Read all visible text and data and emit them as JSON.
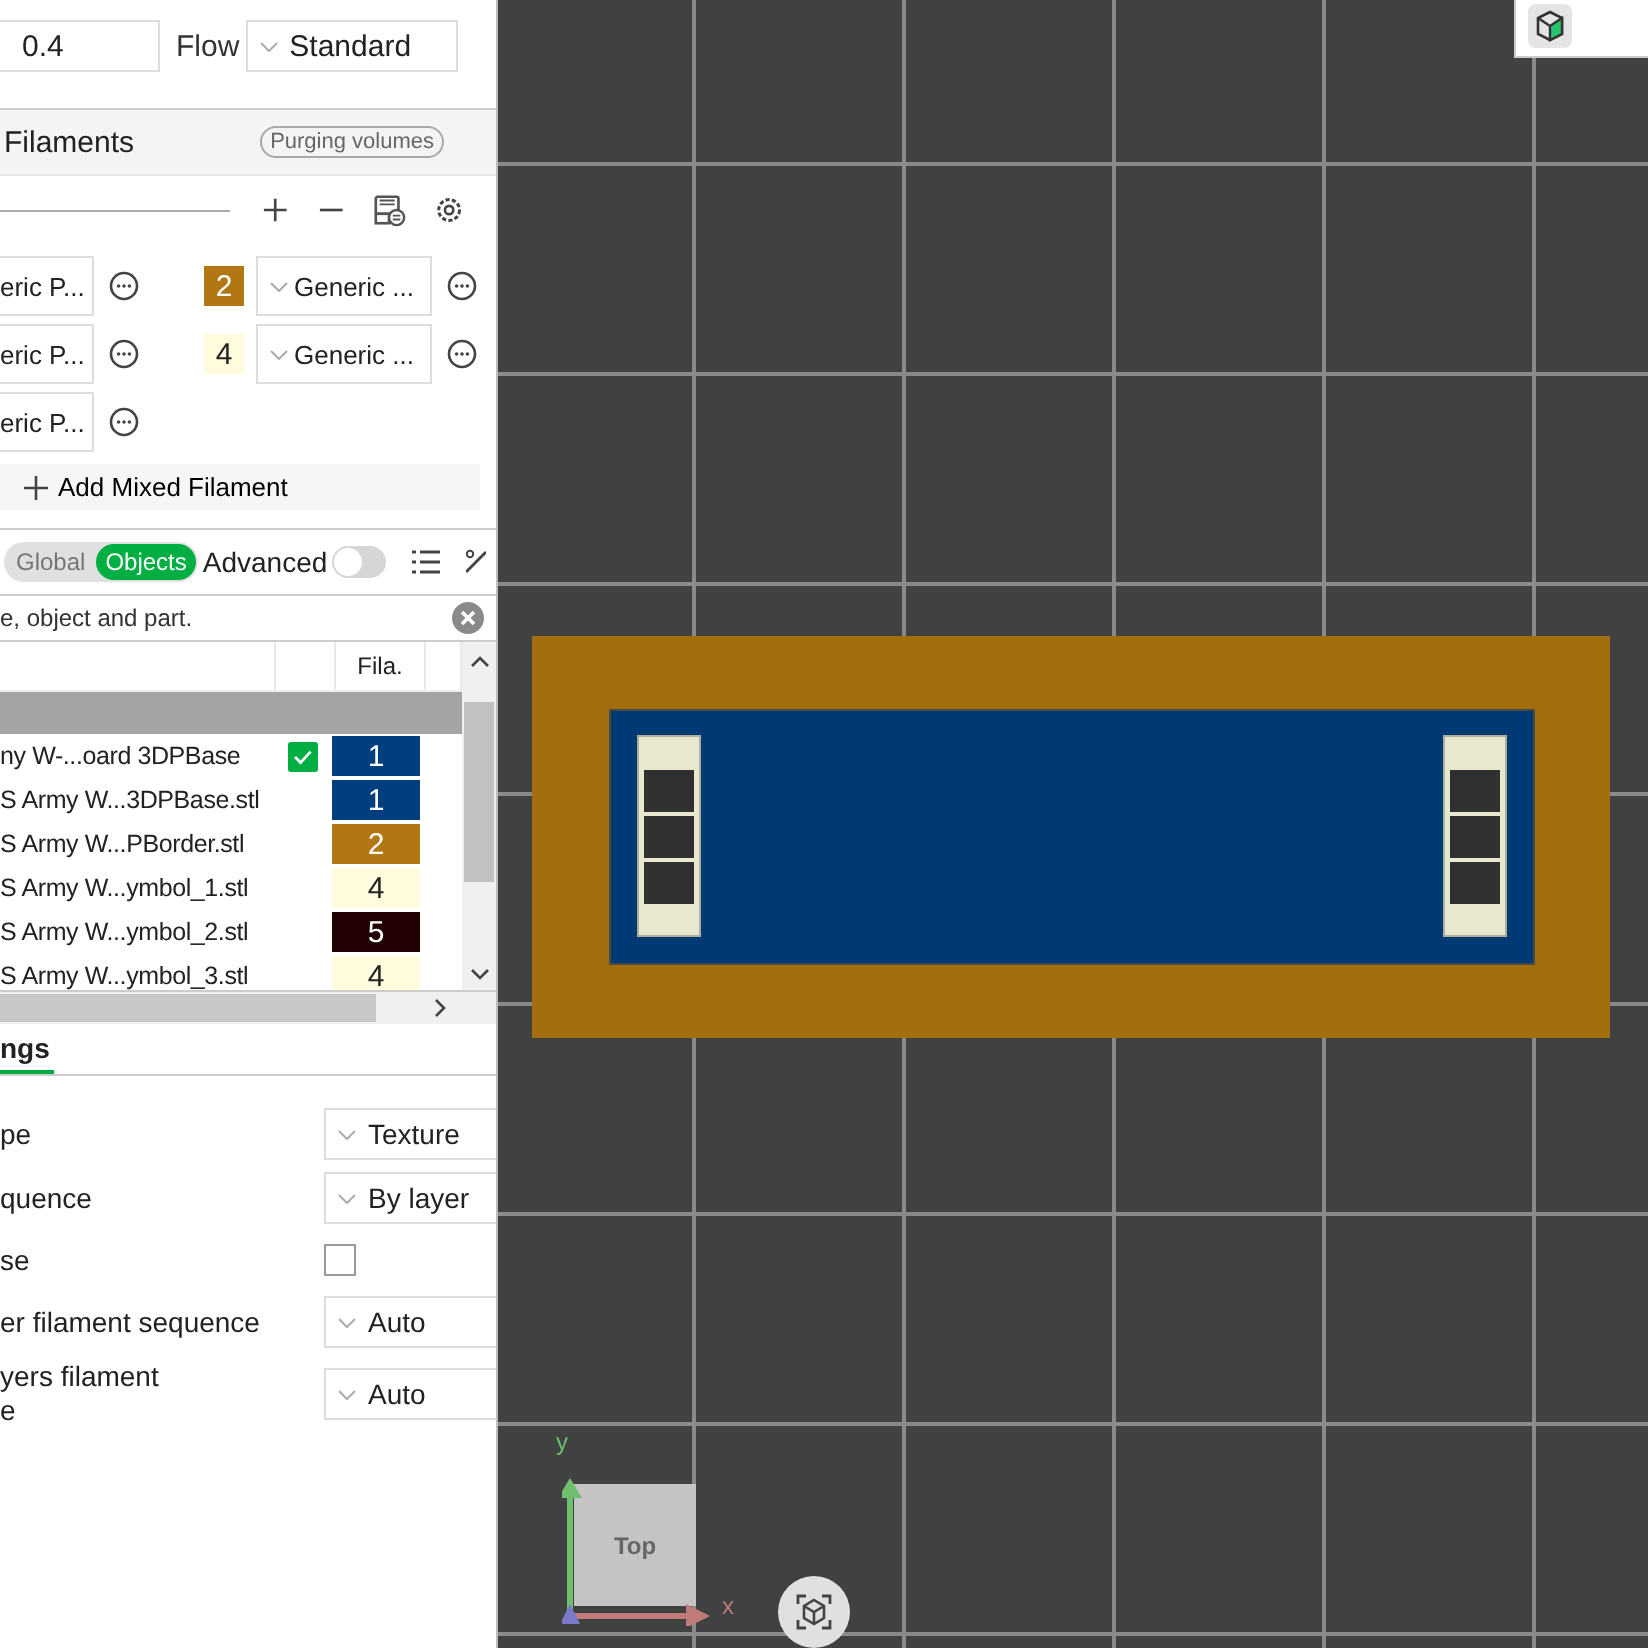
{
  "nozzle": {
    "value": "0.4"
  },
  "flow": {
    "label": "Flow",
    "value": "Standard"
  },
  "filaments": {
    "title": "Filaments",
    "purge_button": "Purging volumes",
    "left": [
      {
        "value": "eric P..."
      },
      {
        "value": "eric P..."
      },
      {
        "value": "eric P..."
      }
    ],
    "right": [
      {
        "number": "2",
        "color": "#b27612",
        "value": "Generic ..."
      },
      {
        "number": "4",
        "color": "#fffbdc",
        "value": "Generic ..."
      }
    ],
    "add_button": "Add Mixed Filament"
  },
  "tabs": [
    {
      "label": "Global",
      "selected": false
    },
    {
      "label": "Objects",
      "selected": true
    }
  ],
  "advanced": {
    "label": "Advanced",
    "on": false
  },
  "search": {
    "placeholder": "e, object and part."
  },
  "table": {
    "columns": [
      {
        "label": "Fila."
      }
    ],
    "rows": [
      {
        "kind": "object",
        "name": "ny W-...oard 3DPBase",
        "checked": true,
        "filament": "1",
        "color": "#003f7f"
      },
      {
        "kind": "part",
        "name": "S Army W...3DPBase.stl",
        "filament": "1",
        "color": "#003f7f"
      },
      {
        "kind": "part",
        "name": "S Army W...PBorder.stl",
        "filament": "2",
        "color": "#b27612"
      },
      {
        "kind": "part",
        "name": "S Army W...ymbol_1.stl",
        "filament": "4",
        "color": "#fffbdc"
      },
      {
        "kind": "part",
        "name": "S Army W...ymbol_2.stl",
        "filament": "5",
        "color": "#200000"
      },
      {
        "kind": "part",
        "name": "S Army W...ymbol_3.stl",
        "filament": "4",
        "color": "#fffbdc"
      }
    ]
  },
  "settings": {
    "tab": {
      "label": "ngs",
      "selected": true
    },
    "rows": [
      {
        "kind": "select",
        "lines": [
          "pe"
        ],
        "value": "Texture"
      },
      {
        "kind": "select",
        "lines": [
          "quence"
        ],
        "value": "By layer"
      },
      {
        "kind": "checkbox",
        "lines": [
          "se"
        ],
        "checked": false
      },
      {
        "kind": "select",
        "lines": [
          "er filament sequence"
        ],
        "value": "Auto"
      },
      {
        "kind": "select",
        "lines": [
          "yers filament",
          "e"
        ],
        "value": "Auto"
      }
    ]
  },
  "view_cube": {
    "label": "Top"
  },
  "axes": {
    "x": "x",
    "y": "y"
  }
}
